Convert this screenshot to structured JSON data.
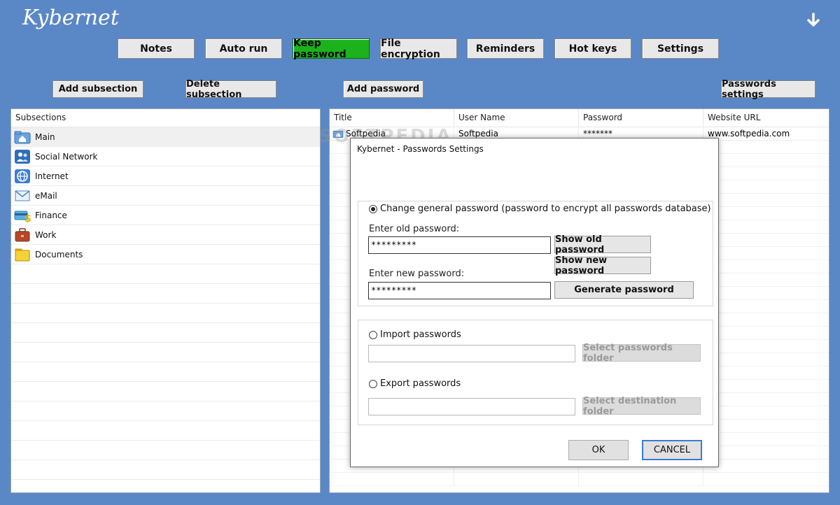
{
  "app": {
    "title": "Kybernet"
  },
  "nav": [
    {
      "label": "Notes",
      "active": false
    },
    {
      "label": "Auto run",
      "active": false
    },
    {
      "label": "Keep password",
      "active": true
    },
    {
      "label": "File encryption",
      "active": false
    },
    {
      "label": "Reminders",
      "active": false
    },
    {
      "label": "Hot keys",
      "active": false
    },
    {
      "label": "Settings",
      "active": false
    }
  ],
  "actions": {
    "add_subsection": "Add subsection",
    "delete_subsection": "Delete subsection",
    "add_password": "Add password",
    "passwords_settings": "Passwords settings"
  },
  "subsections": {
    "header": "Subsections",
    "items": [
      {
        "label": "Main",
        "icon": "home-folder-icon",
        "selected": true
      },
      {
        "label": "Social Network",
        "icon": "social-network-icon",
        "selected": false
      },
      {
        "label": "Internet",
        "icon": "internet-globe-icon",
        "selected": false
      },
      {
        "label": "eMail",
        "icon": "envelope-icon",
        "selected": false
      },
      {
        "label": "Finance",
        "icon": "finance-card-icon",
        "selected": false
      },
      {
        "label": "Work",
        "icon": "briefcase-icon",
        "selected": false
      },
      {
        "label": "Documents",
        "icon": "folder-icon",
        "selected": false
      }
    ]
  },
  "passwords_table": {
    "columns": [
      "Title",
      "User Name",
      "Password",
      "Website URL"
    ],
    "rows": [
      {
        "title": "Softpedia",
        "user": "Softpedia",
        "password": "*******",
        "url": "www.softpedia.com"
      }
    ]
  },
  "watermark": "SOFTPEDIA",
  "dialog": {
    "title": "Kybernet - Passwords Settings",
    "change_general": {
      "label": "Change general password (password to encrypt all passwords database)",
      "selected": true,
      "old_label": "Enter old password:",
      "old_value": "*********",
      "new_label": "Enter new password:",
      "new_value": "*********",
      "show_old": "Show old password",
      "show_new": "Show new password",
      "generate": "Generate password"
    },
    "import": {
      "label": "Import passwords",
      "selected": false,
      "path": "",
      "button": "Select passwords folder"
    },
    "export": {
      "label": "Export passwords",
      "selected": false,
      "path": "",
      "button": "Select destination folder"
    },
    "ok": "OK",
    "cancel": "CANCEL"
  },
  "colors": {
    "background": "#5a87c5",
    "active_tab": "#1bb21b",
    "focus": "#3a7bd5"
  }
}
